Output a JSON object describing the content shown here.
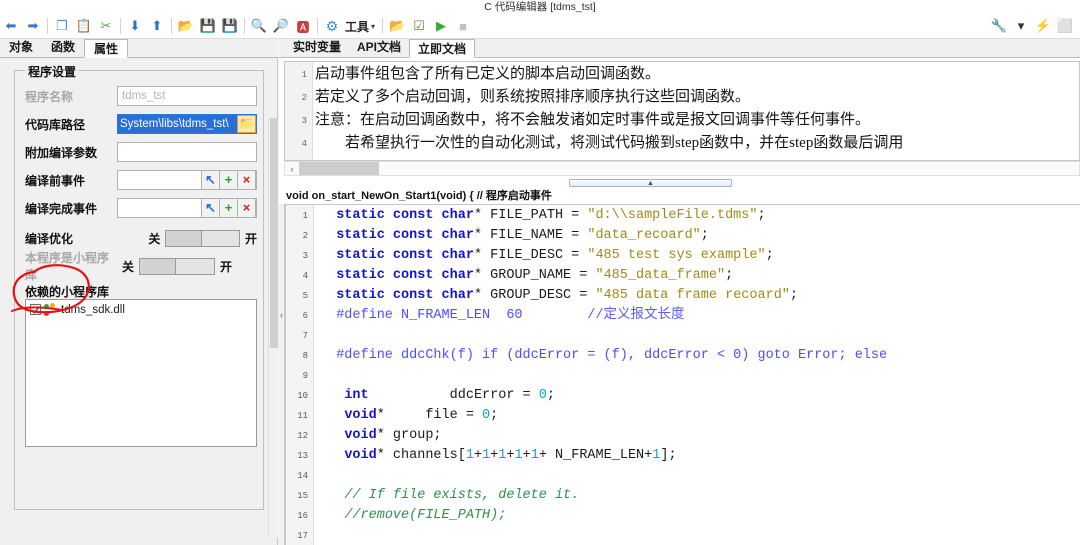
{
  "window": {
    "title": "C 代码编辑器 [tdms_tst]"
  },
  "toolbar": {
    "buttons": [
      {
        "name": "undo-icon",
        "glyph": "⬅",
        "color": "#3a79c4"
      },
      {
        "name": "redo-icon",
        "glyph": "➡",
        "color": "#3a79c4"
      },
      {
        "name": "copy-icon",
        "glyph": "❐",
        "color": "#4a8fd4"
      },
      {
        "name": "paste-icon",
        "glyph": "📋",
        "color": "#d9a43c"
      },
      {
        "name": "cut-icon",
        "glyph": "✂",
        "color": "#5aa84f"
      },
      {
        "name": "move-down-icon",
        "glyph": "⬇",
        "color": "#2f6fc4"
      },
      {
        "name": "move-up-icon",
        "glyph": "⬆",
        "color": "#2f6fc4"
      },
      {
        "name": "open-folder-icon",
        "glyph": "📂",
        "color": "#e0a63c"
      },
      {
        "name": "save-icon",
        "glyph": "💾",
        "color": "#9a5fc4"
      },
      {
        "name": "save-as-icon",
        "glyph": "💾",
        "color": "#9a5fc4"
      },
      {
        "name": "find-icon",
        "glyph": "🔍",
        "color": "#3a79c4"
      },
      {
        "name": "find-next-icon",
        "glyph": "🔎",
        "color": "#3a79c4"
      },
      {
        "name": "replace-icon",
        "glyph": "🅰",
        "color": "#c44040"
      }
    ],
    "tools_label": "工具",
    "tools_caret": "▾",
    "right_buttons": [
      {
        "name": "open-project-icon",
        "glyph": "📂",
        "color": "#e0a63c"
      },
      {
        "name": "compile-icon",
        "glyph": "☑",
        "color": "#5a8a3a"
      },
      {
        "name": "run-icon",
        "glyph": "▶",
        "color": "#33b033"
      },
      {
        "name": "stop-icon",
        "glyph": "■",
        "color": "#c0c0c0"
      }
    ],
    "far_right_buttons": [
      {
        "name": "wrench-icon",
        "glyph": "🔧",
        "color": "#3a79c4"
      },
      {
        "name": "chevron-down-icon",
        "glyph": "▾",
        "color": "#333333"
      },
      {
        "name": "lightning-icon",
        "glyph": "⚡",
        "color": "#f0a81e"
      },
      {
        "name": "window-icon",
        "glyph": "⬜",
        "color": "#3a79c4"
      }
    ]
  },
  "left_tabs": [
    {
      "label": "对象",
      "active": false
    },
    {
      "label": "函数",
      "active": false
    },
    {
      "label": "属性",
      "active": true
    }
  ],
  "settings": {
    "group_title": "程序设置",
    "fields": [
      {
        "label": "程序名称",
        "value": "tdms_tst",
        "state": "readonly"
      },
      {
        "label": "代码库路径",
        "value": "System\\libs\\tdms_tst\\",
        "state": "selected"
      },
      {
        "label": "附加编译参数",
        "value": "",
        "state": "normal"
      },
      {
        "label": "编译前事件",
        "value": "",
        "state": "with-buttons"
      },
      {
        "label": "编译完成事件",
        "value": "",
        "state": "with-buttons"
      }
    ],
    "mini_buttons": [
      {
        "name": "pick-event-button",
        "glyph": "↖"
      },
      {
        "name": "add-event-button",
        "glyph": "+"
      },
      {
        "name": "delete-event-button",
        "glyph": "×"
      }
    ],
    "toggles": [
      {
        "label": "编译优化",
        "off": "关",
        "on": "开",
        "value": "off",
        "dim": false
      },
      {
        "label": "本程序是小程序库",
        "off": "关",
        "on": "开",
        "value": "off",
        "dim": true
      }
    ],
    "dependency": {
      "title": "依赖的小程序库",
      "items": [
        {
          "name": "tdms_sdk.dll",
          "checked": true
        }
      ]
    }
  },
  "right_tabs": [
    {
      "label": "实时变量",
      "active": false
    },
    {
      "label": "API文档",
      "active": false
    },
    {
      "label": "立即文档",
      "active": true
    }
  ],
  "doc_pane": {
    "line_numbers": [
      "1",
      "2",
      "3",
      "4"
    ],
    "lines": [
      {
        "text": "启动事件组包含了所有已定义的脚本启动回调函数。",
        "indent": false
      },
      {
        "text": "若定义了多个启动回调，则系统按照排序顺序执行这些回调函数。",
        "indent": false
      },
      {
        "text": "注意：在启动回调函数中，将不会触发诸如定时事件或是报文回调事件等任何事件。",
        "indent": false
      },
      {
        "text": "若希望执行一次性的自动化测试，将测试代码搬到step函数中，并在step函数最后调用",
        "indent": true
      }
    ]
  },
  "code_header": "void on_start_NewOn_Start1(void) { // 程序启动事件",
  "code_pane": {
    "line_numbers": [
      "1",
      "2",
      "3",
      "4",
      "5",
      "6",
      "7",
      "8",
      "9",
      "10",
      "11",
      "12",
      "13",
      "14",
      "15",
      "16",
      "17"
    ],
    "lines": [
      {
        "n": "1",
        "tokens": [
          {
            "t": "  ",
            "c": "pln"
          },
          {
            "t": "static const char",
            "c": "kw"
          },
          {
            "t": "* FILE_PATH = ",
            "c": "pln"
          },
          {
            "t": "\"d:\\\\sampleFile.tdms\"",
            "c": "str"
          },
          {
            "t": ";",
            "c": "pln"
          }
        ]
      },
      {
        "n": "2",
        "tokens": [
          {
            "t": "  ",
            "c": "pln"
          },
          {
            "t": "static const char",
            "c": "kw"
          },
          {
            "t": "* FILE_NAME = ",
            "c": "pln"
          },
          {
            "t": "\"data_recoard\"",
            "c": "str"
          },
          {
            "t": ";",
            "c": "pln"
          }
        ]
      },
      {
        "n": "3",
        "tokens": [
          {
            "t": "  ",
            "c": "pln"
          },
          {
            "t": "static const char",
            "c": "kw"
          },
          {
            "t": "* FILE_DESC = ",
            "c": "pln"
          },
          {
            "t": "\"485 test sys example\"",
            "c": "str"
          },
          {
            "t": ";",
            "c": "pln"
          }
        ]
      },
      {
        "n": "4",
        "tokens": [
          {
            "t": "  ",
            "c": "pln"
          },
          {
            "t": "static const char",
            "c": "kw"
          },
          {
            "t": "* GROUP_NAME = ",
            "c": "pln"
          },
          {
            "t": "\"485_data_frame\"",
            "c": "str"
          },
          {
            "t": ";",
            "c": "pln"
          }
        ]
      },
      {
        "n": "5",
        "tokens": [
          {
            "t": "  ",
            "c": "pln"
          },
          {
            "t": "static const char",
            "c": "kw"
          },
          {
            "t": "* GROUP_DESC = ",
            "c": "pln"
          },
          {
            "t": "\"485 data frame recoard\"",
            "c": "str"
          },
          {
            "t": ";",
            "c": "pln"
          }
        ]
      },
      {
        "n": "6",
        "tokens": [
          {
            "t": "  ",
            "c": "pln"
          },
          {
            "t": "#define N_FRAME_LEN  60",
            "c": "pre"
          },
          {
            "t": "        ",
            "c": "pln"
          },
          {
            "t": "//定义报文长度",
            "c": "cmt2"
          }
        ]
      },
      {
        "n": "7",
        "tokens": [
          {
            "t": "",
            "c": "pln"
          }
        ]
      },
      {
        "n": "8",
        "tokens": [
          {
            "t": "  ",
            "c": "pln"
          },
          {
            "t": "#define ddcChk(f) if (ddcError = (f), ddcError < 0) goto Error; else",
            "c": "pre"
          }
        ]
      },
      {
        "n": "9",
        "tokens": [
          {
            "t": "",
            "c": "pln"
          }
        ]
      },
      {
        "n": "10",
        "tokens": [
          {
            "t": "   ",
            "c": "pln"
          },
          {
            "t": "int",
            "c": "kw"
          },
          {
            "t": "          ddcError = ",
            "c": "pln"
          },
          {
            "t": "0",
            "c": "num"
          },
          {
            "t": ";",
            "c": "pln"
          }
        ]
      },
      {
        "n": "11",
        "tokens": [
          {
            "t": "   ",
            "c": "pln"
          },
          {
            "t": "void",
            "c": "kw"
          },
          {
            "t": "*     file = ",
            "c": "pln"
          },
          {
            "t": "0",
            "c": "num"
          },
          {
            "t": ";",
            "c": "pln"
          }
        ]
      },
      {
        "n": "12",
        "tokens": [
          {
            "t": "   ",
            "c": "pln"
          },
          {
            "t": "void",
            "c": "kw"
          },
          {
            "t": "* group;",
            "c": "pln"
          }
        ]
      },
      {
        "n": "13",
        "tokens": [
          {
            "t": "   ",
            "c": "pln"
          },
          {
            "t": "void",
            "c": "kw"
          },
          {
            "t": "* channels[",
            "c": "pln"
          },
          {
            "t": "1",
            "c": "num"
          },
          {
            "t": "+",
            "c": "pln"
          },
          {
            "t": "1",
            "c": "num"
          },
          {
            "t": "+",
            "c": "pln"
          },
          {
            "t": "1",
            "c": "num"
          },
          {
            "t": "+",
            "c": "pln"
          },
          {
            "t": "1",
            "c": "num"
          },
          {
            "t": "+",
            "c": "pln"
          },
          {
            "t": "1",
            "c": "num"
          },
          {
            "t": "+ N_FRAME_LEN+",
            "c": "pln"
          },
          {
            "t": "1",
            "c": "num"
          },
          {
            "t": "];",
            "c": "pln"
          }
        ]
      },
      {
        "n": "14",
        "tokens": [
          {
            "t": "",
            "c": "pln"
          }
        ]
      },
      {
        "n": "15",
        "tokens": [
          {
            "t": "   ",
            "c": "pln"
          },
          {
            "t": "// If file exists, delete it.",
            "c": "cmt"
          }
        ]
      },
      {
        "n": "16",
        "tokens": [
          {
            "t": "   ",
            "c": "pln"
          },
          {
            "t": "//remove(FILE_PATH);",
            "c": "cmt"
          }
        ]
      },
      {
        "n": "17",
        "tokens": [
          {
            "t": "",
            "c": "pln"
          }
        ]
      }
    ]
  },
  "annotation": {
    "color": "#e81010",
    "shape": "hand-drawn-ellipse"
  },
  "scrollbars": {
    "doc_h_arrow": "‹",
    "split_grip_glyph": "▲"
  }
}
